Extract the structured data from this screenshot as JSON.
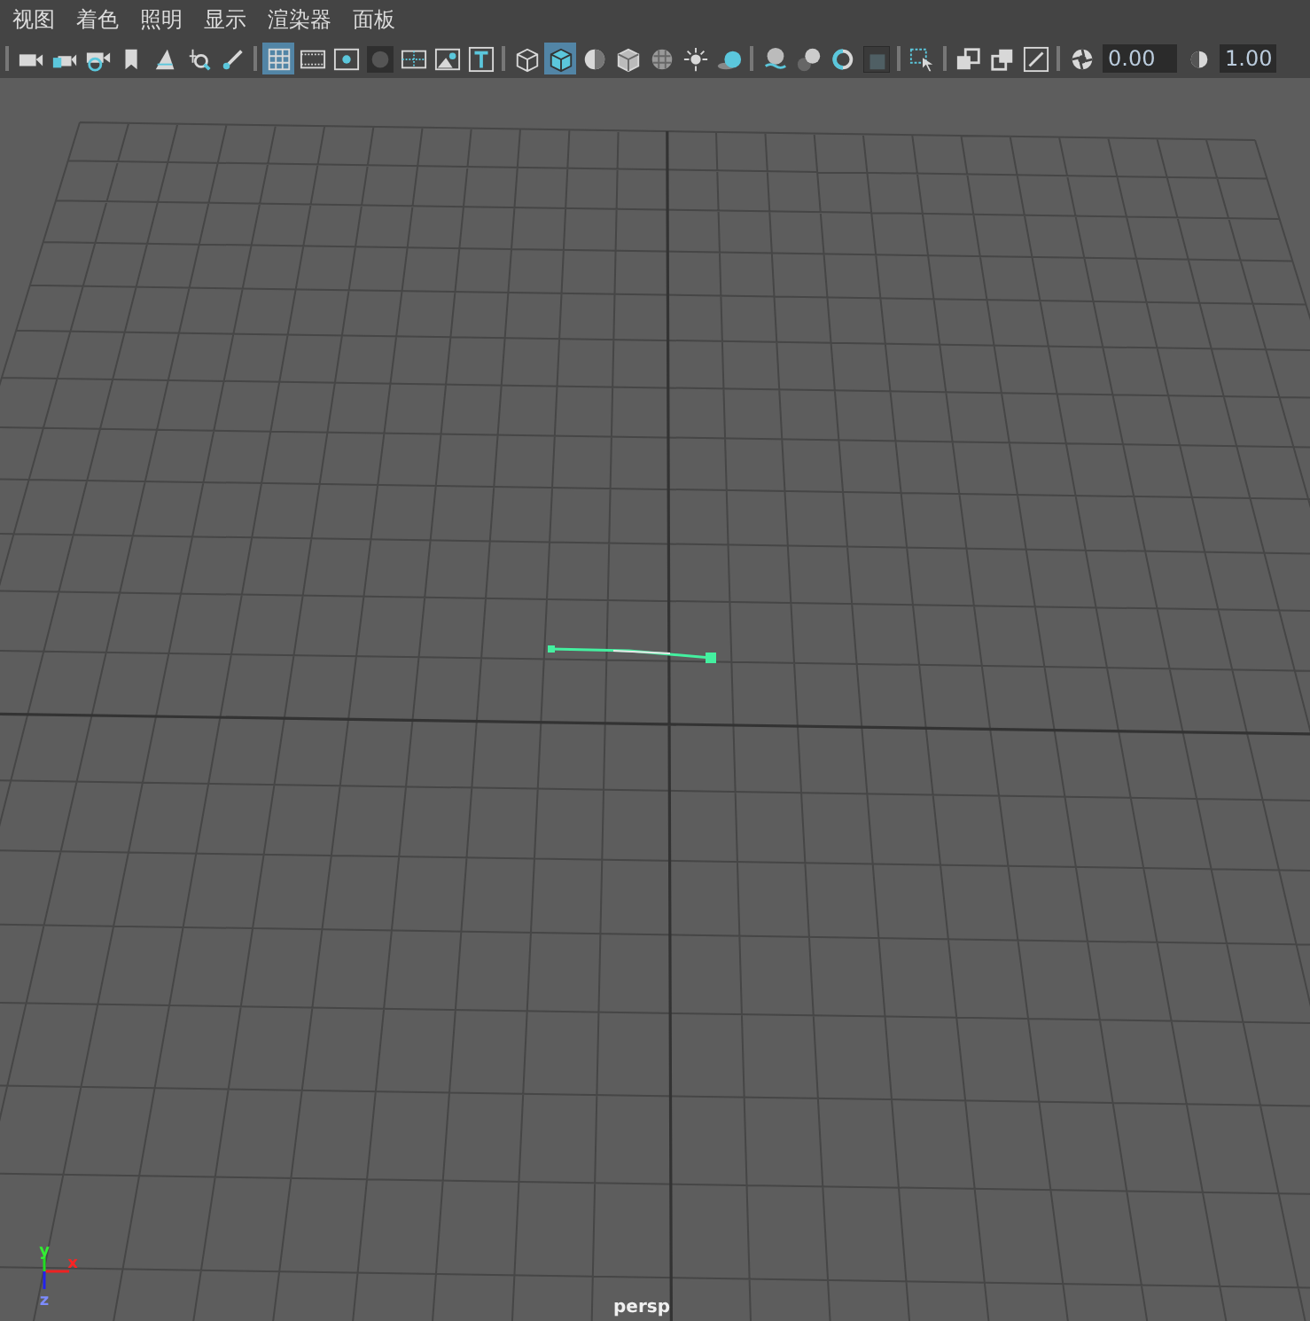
{
  "menu": [
    {
      "label": "视图"
    },
    {
      "label": "着色"
    },
    {
      "label": "照明"
    },
    {
      "label": "显示"
    },
    {
      "label": "渲染器"
    },
    {
      "label": "面板"
    }
  ],
  "toolbar": {
    "groups": [
      {
        "items": [
          {
            "kind": "button",
            "selected": false
          },
          {
            "kind": "button",
            "selected": false
          },
          {
            "kind": "button",
            "selected": false
          },
          {
            "kind": "button",
            "selected": false
          },
          {
            "kind": "button",
            "selected": false
          },
          {
            "kind": "button",
            "selected": false
          },
          {
            "kind": "button",
            "selected": false
          }
        ]
      },
      {
        "items": [
          {
            "kind": "button",
            "selected": true
          },
          {
            "kind": "button",
            "selected": false
          },
          {
            "kind": "button",
            "selected": false
          },
          {
            "kind": "button",
            "selected": false
          },
          {
            "kind": "button",
            "selected": false
          },
          {
            "kind": "button",
            "selected": false
          },
          {
            "kind": "button",
            "selected": false
          }
        ]
      },
      {
        "items": [
          {
            "kind": "button",
            "selected": false
          },
          {
            "kind": "button",
            "selected": true
          },
          {
            "kind": "button",
            "selected": false
          },
          {
            "kind": "button",
            "selected": false
          },
          {
            "kind": "button",
            "selected": false
          },
          {
            "kind": "button",
            "selected": false
          },
          {
            "kind": "button",
            "selected": false
          }
        ]
      },
      {
        "items": [
          {
            "kind": "button",
            "selected": false
          },
          {
            "kind": "button",
            "selected": false
          },
          {
            "kind": "button",
            "selected": false
          },
          {
            "kind": "button",
            "selected": false
          }
        ]
      },
      {
        "items": [
          {
            "kind": "button",
            "selected": false
          }
        ]
      },
      {
        "items": [
          {
            "kind": "button",
            "selected": false
          },
          {
            "kind": "button",
            "selected": false
          },
          {
            "kind": "button",
            "selected": false
          }
        ]
      },
      {
        "items": [
          {
            "kind": "button",
            "selected": false
          },
          {
            "kind": "field",
            "value": "0.00"
          },
          {
            "kind": "button",
            "selected": false
          },
          {
            "kind": "field",
            "value": "1.00"
          }
        ]
      }
    ]
  },
  "viewport": {
    "camera": "persp",
    "axes": [
      {
        "label": "x"
      },
      {
        "label": "y"
      },
      {
        "label": "z"
      }
    ]
  }
}
